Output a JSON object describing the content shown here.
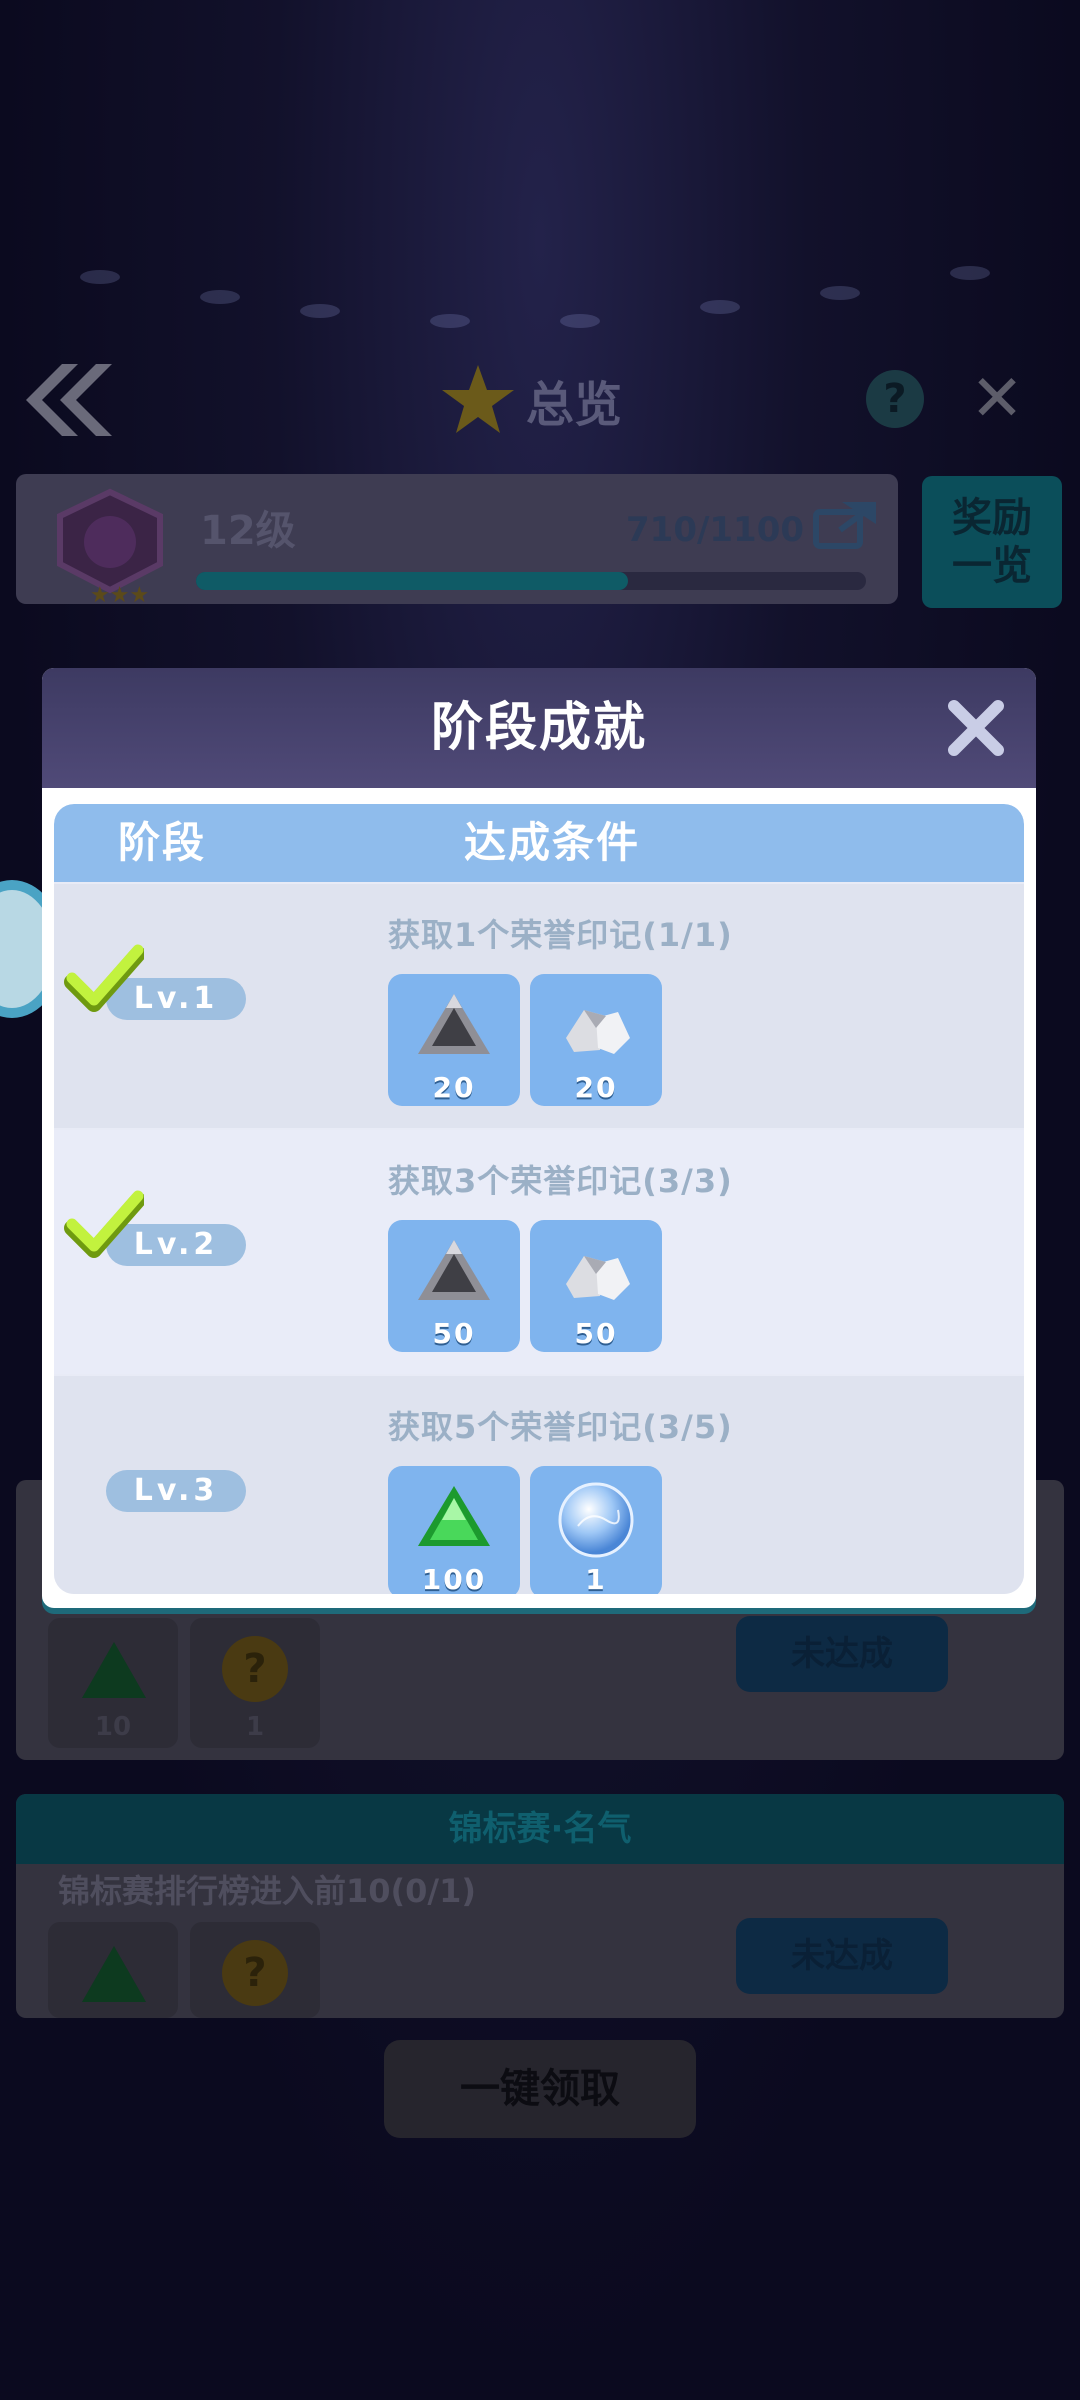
{
  "header": {
    "title": "总览",
    "help_label": "?"
  },
  "player": {
    "level_label": "12级",
    "xp_text": "710/1100",
    "xp_fraction": 0.645
  },
  "reward_list_button": [
    "奖励",
    "一览"
  ],
  "background_sections": [
    {
      "title": "",
      "condition": "",
      "rewards": [
        {
          "amount": "10"
        },
        {
          "amount": "1"
        }
      ],
      "button": "未达成"
    },
    {
      "title": "锦标赛·名气",
      "condition": "锦标赛排行榜进入前10(0/1)",
      "rewards": [
        {
          "amount": ""
        },
        {
          "amount": ""
        }
      ],
      "button": "未达成"
    }
  ],
  "claim_all_button": "一键领取",
  "modal": {
    "title": "阶段成就",
    "columns": {
      "stage": "阶段",
      "condition": "达成条件"
    },
    "rows": [
      {
        "level": "Lv.1",
        "completed": true,
        "condition": "获取1个荣誉印记(1/1)",
        "rewards": [
          {
            "icon": "silver-triangle-gem-icon",
            "amount": "20"
          },
          {
            "icon": "silver-ore-icon",
            "amount": "20"
          }
        ]
      },
      {
        "level": "Lv.2",
        "completed": true,
        "condition": "获取3个荣誉印记(3/3)",
        "rewards": [
          {
            "icon": "silver-triangle-gem-icon",
            "amount": "50"
          },
          {
            "icon": "silver-ore-icon",
            "amount": "50"
          }
        ]
      },
      {
        "level": "Lv.3",
        "completed": false,
        "condition": "获取5个荣誉印记(3/5)",
        "rewards": [
          {
            "icon": "green-gem-icon",
            "amount": "100"
          },
          {
            "icon": "crystal-orb-icon",
            "amount": "1"
          }
        ]
      }
    ]
  },
  "colors": {
    "modal_header": "#45406c",
    "table_header": "#8fbcec",
    "reward_tile": "#7fb4ee",
    "level_pill": "#9ebfe0",
    "check": "#b6ef3a"
  }
}
